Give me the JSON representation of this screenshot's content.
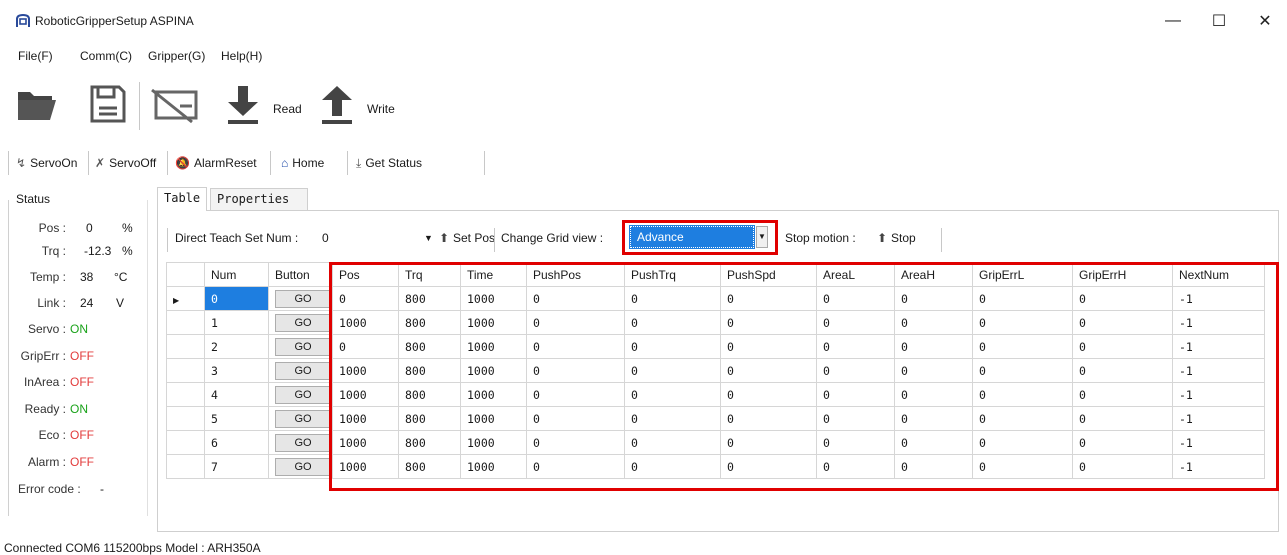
{
  "window": {
    "title": "RoboticGripperSetup ASPINA"
  },
  "menu": [
    "File(F)",
    "Comm(C)",
    "Gripper(G)",
    "Help(H)"
  ],
  "toolbar": {
    "read_label": "Read",
    "write_label": "Write"
  },
  "actions": [
    {
      "label": "ServoOn",
      "icon": "servo-on-icon"
    },
    {
      "label": "ServoOff",
      "icon": "servo-off-icon"
    },
    {
      "label": "AlarmReset",
      "icon": "alarm-reset-icon"
    },
    {
      "label": "Home",
      "icon": "home-icon"
    },
    {
      "label": "Get Status",
      "icon": "get-status-icon"
    }
  ],
  "status": {
    "caption": "Status",
    "pos": {
      "label": "Pos :",
      "value": "0",
      "unit": "%"
    },
    "trq": {
      "label": "Trq :",
      "value": "-12.3",
      "unit": "%"
    },
    "temp": {
      "label": "Temp :",
      "value": "38",
      "unit": "°C"
    },
    "link": {
      "label": "Link :",
      "value": "24",
      "unit": "V"
    },
    "servo": {
      "label": "Servo :",
      "value": "ON"
    },
    "griperr": {
      "label": "GripErr :",
      "value": "OFF"
    },
    "inarea": {
      "label": "InArea :",
      "value": "OFF"
    },
    "ready": {
      "label": "Ready :",
      "value": "ON"
    },
    "eco": {
      "label": "Eco :",
      "value": "OFF"
    },
    "alarm": {
      "label": "Alarm :",
      "value": "OFF"
    },
    "errorcode": {
      "label": "Error code :",
      "value": "-"
    }
  },
  "tabs": [
    "Table",
    "Properties"
  ],
  "teach": {
    "label": "Direct Teach Set Num :",
    "value": "0",
    "setpos_label": "Set Pos",
    "gridview_label": "Change Grid view :",
    "gridview_value": "Advance",
    "stop_label": "Stop motion :",
    "stop_button": "Stop"
  },
  "grid": {
    "columns": [
      "Num",
      "Button",
      "Pos",
      "Trq",
      "Time",
      "PushPos",
      "PushTrq",
      "PushSpd",
      "AreaL",
      "AreaH",
      "GripErrL",
      "GripErrH",
      "NextNum"
    ],
    "go_label": "GO",
    "rows": [
      [
        "0",
        "0",
        "800",
        "1000",
        "0",
        "0",
        "0",
        "0",
        "0",
        "0",
        "0",
        "-1"
      ],
      [
        "1",
        "1000",
        "800",
        "1000",
        "0",
        "0",
        "0",
        "0",
        "0",
        "0",
        "0",
        "-1"
      ],
      [
        "2",
        "0",
        "800",
        "1000",
        "0",
        "0",
        "0",
        "0",
        "0",
        "0",
        "0",
        "-1"
      ],
      [
        "3",
        "1000",
        "800",
        "1000",
        "0",
        "0",
        "0",
        "0",
        "0",
        "0",
        "0",
        "-1"
      ],
      [
        "4",
        "1000",
        "800",
        "1000",
        "0",
        "0",
        "0",
        "0",
        "0",
        "0",
        "0",
        "-1"
      ],
      [
        "5",
        "1000",
        "800",
        "1000",
        "0",
        "0",
        "0",
        "0",
        "0",
        "0",
        "0",
        "-1"
      ],
      [
        "6",
        "1000",
        "800",
        "1000",
        "0",
        "0",
        "0",
        "0",
        "0",
        "0",
        "0",
        "-1"
      ],
      [
        "7",
        "1000",
        "800",
        "1000",
        "0",
        "0",
        "0",
        "0",
        "0",
        "0",
        "0",
        "-1"
      ]
    ]
  },
  "statusbar": {
    "text": "Connected COM6 115200bps  Model : ARH350A"
  },
  "colors": {
    "accent": "#1e7ee0",
    "highlight": "#e00000",
    "on": "#1aa31a",
    "off": "#e23b3b"
  }
}
